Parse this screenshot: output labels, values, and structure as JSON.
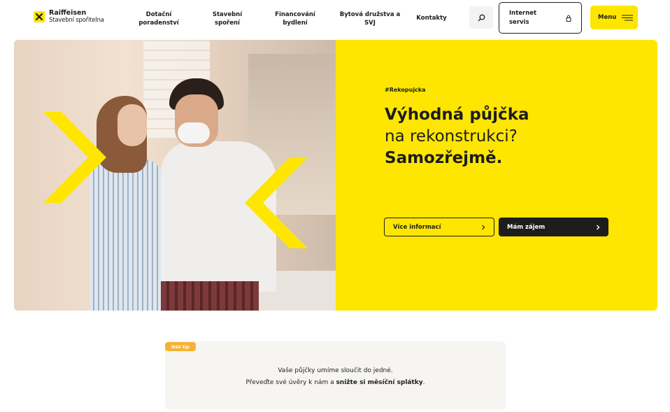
{
  "brand": {
    "name": "Raiffeisen",
    "subtitle": "Stavební spořitelna",
    "accent": "#fee600",
    "dark": "#1d1d1b",
    "badge_color": "#f5b335"
  },
  "nav": {
    "items": [
      {
        "label": "Dotační poradenství"
      },
      {
        "label": "Stavební spoření"
      },
      {
        "label": "Financování bydlení"
      },
      {
        "label": "Bytová družstva a SVJ"
      },
      {
        "label": "Kontakty"
      }
    ],
    "search_icon": "search-icon",
    "internet_servis": "Internet servis",
    "lock_icon": "lock-icon",
    "menu_label": "Menu",
    "menu_icon": "hamburger-icon"
  },
  "hero": {
    "tag": "#Rekopujcka",
    "headline_line1": "Výhodná půjčka",
    "headline_line2": "na rekonstrukci?",
    "headline_line3": "Samozřejmě.",
    "btn_more": "Více informací",
    "btn_interest": "Mám zájem"
  },
  "tip": {
    "badge": "Náš tip",
    "line1": "Vaše půjčky umíme sloučit do jedné.",
    "line2_prefix": "Převeďte své úvěry k nám a ",
    "line2_bold": "snižte si měsíční splátky",
    "line2_suffix": "."
  }
}
